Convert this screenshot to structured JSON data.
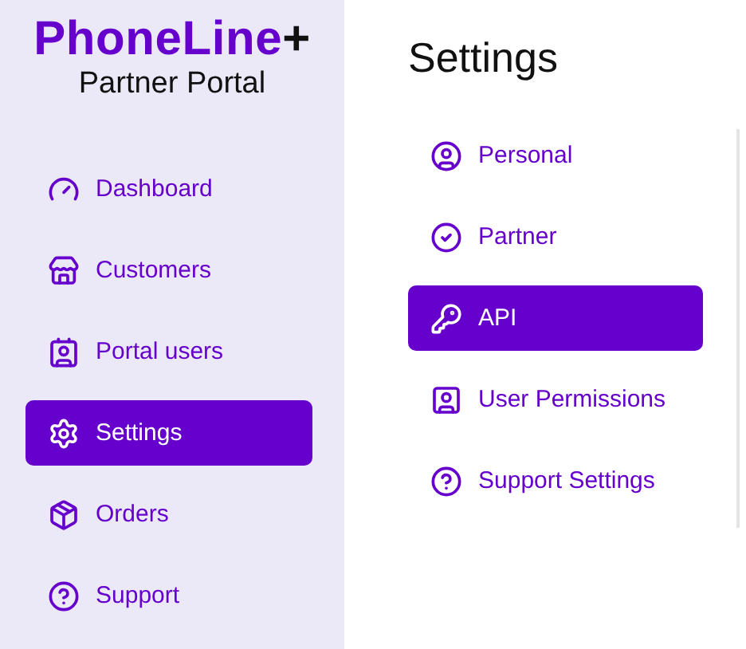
{
  "logo": {
    "name": "PhoneLine",
    "plus": "+",
    "subtitle": "Partner Portal"
  },
  "nav": [
    {
      "label": "Dashboard",
      "selected": false
    },
    {
      "label": "Customers",
      "selected": false
    },
    {
      "label": "Portal users",
      "selected": false
    },
    {
      "label": "Settings",
      "selected": true
    },
    {
      "label": "Orders",
      "selected": false
    },
    {
      "label": "Support",
      "selected": false
    }
  ],
  "settings": {
    "title": "Settings",
    "items": [
      {
        "label": "Personal",
        "selected": false
      },
      {
        "label": "Partner",
        "selected": false
      },
      {
        "label": "API",
        "selected": true
      },
      {
        "label": "User Permissions",
        "selected": false
      },
      {
        "label": "Support Settings",
        "selected": false
      }
    ]
  }
}
